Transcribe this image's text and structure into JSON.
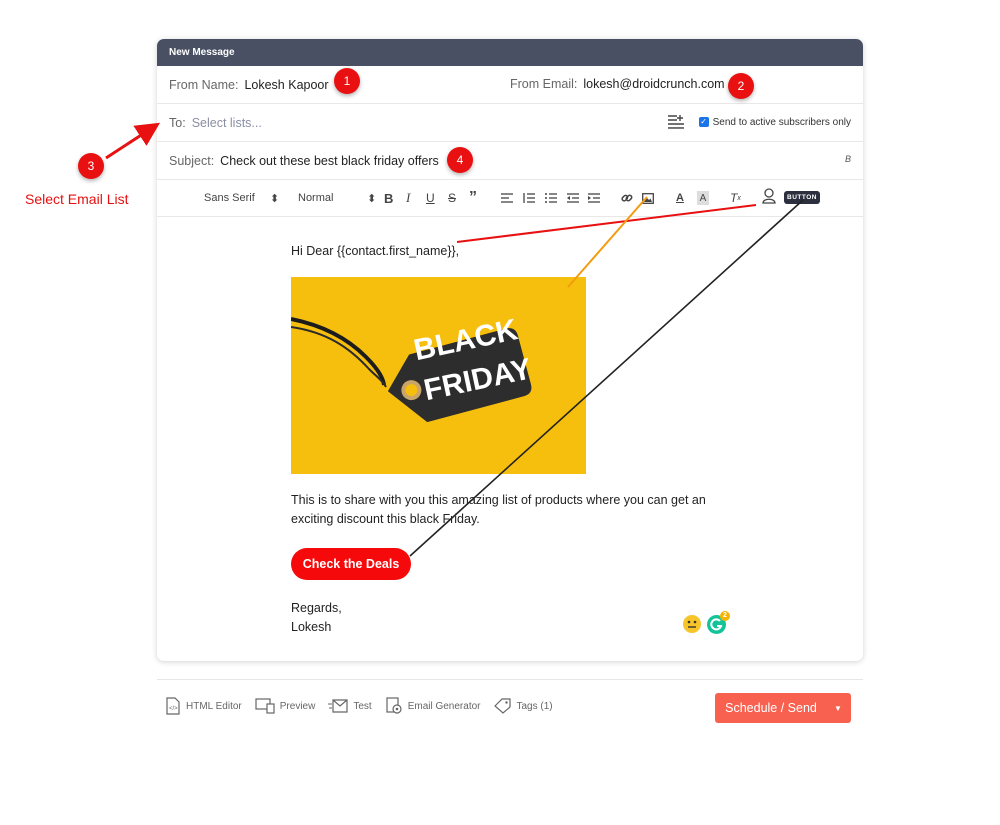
{
  "window": {
    "title": "New Message"
  },
  "fields": {
    "from_name_label": "From Name:",
    "from_name_value": "Lokesh Kapoor",
    "from_email_label": "From Email:",
    "from_email_value": "lokesh@droidcrunch.com",
    "to_label": "To:",
    "to_placeholder": "Select lists...",
    "send_active_label": "Send to active subscribers only",
    "send_active_checked": true,
    "subject_label": "Subject:",
    "subject_value": "Check out these best black friday offers",
    "subject_format_letter": "B"
  },
  "toolbar": {
    "font_select": "Sans Serif",
    "size_select": "Normal",
    "button_chip": "BUTTON",
    "icons": [
      "bold-icon",
      "italic-icon",
      "underline-icon",
      "strikethrough-icon",
      "quote-icon",
      "align-left-icon",
      "ordered-list-icon",
      "bullet-list-icon",
      "outdent-icon",
      "indent-icon",
      "link-icon",
      "image-icon",
      "text-color-icon",
      "highlight-icon",
      "clear-format-icon",
      "personalize-icon"
    ]
  },
  "body": {
    "greeting": "Hi Dear {{contact.first_name}},",
    "image_text_line1": "BLACK",
    "image_text_line2": "FRIDAY",
    "paragraph": "This is to share with you this amazing list of products where you can get an exciting discount this black Friday.",
    "cta_label": "Check the Deals",
    "regards_line1": "Regards,",
    "regards_line2": "Lokesh",
    "grammarly_badge": "2"
  },
  "footer": {
    "html_editor": "HTML Editor",
    "preview": "Preview",
    "test": "Test",
    "email_generator": "Email Generator",
    "tags": "Tags (1)",
    "send_button": "Schedule / Send"
  },
  "annotations": {
    "markers": [
      "1",
      "2",
      "3",
      "4"
    ],
    "select_list_label": "Select Email List",
    "colors": {
      "marker": "#e81010",
      "arrow_red": "#e81010",
      "arrow_orange": "#f39c12",
      "arrow_dark": "#222222"
    }
  },
  "colors": {
    "header": "#4a5064",
    "cta": "#f5090b",
    "send": "#f86150",
    "hero_bg": "#f7bf0d",
    "tag": "#2c2c2c"
  }
}
